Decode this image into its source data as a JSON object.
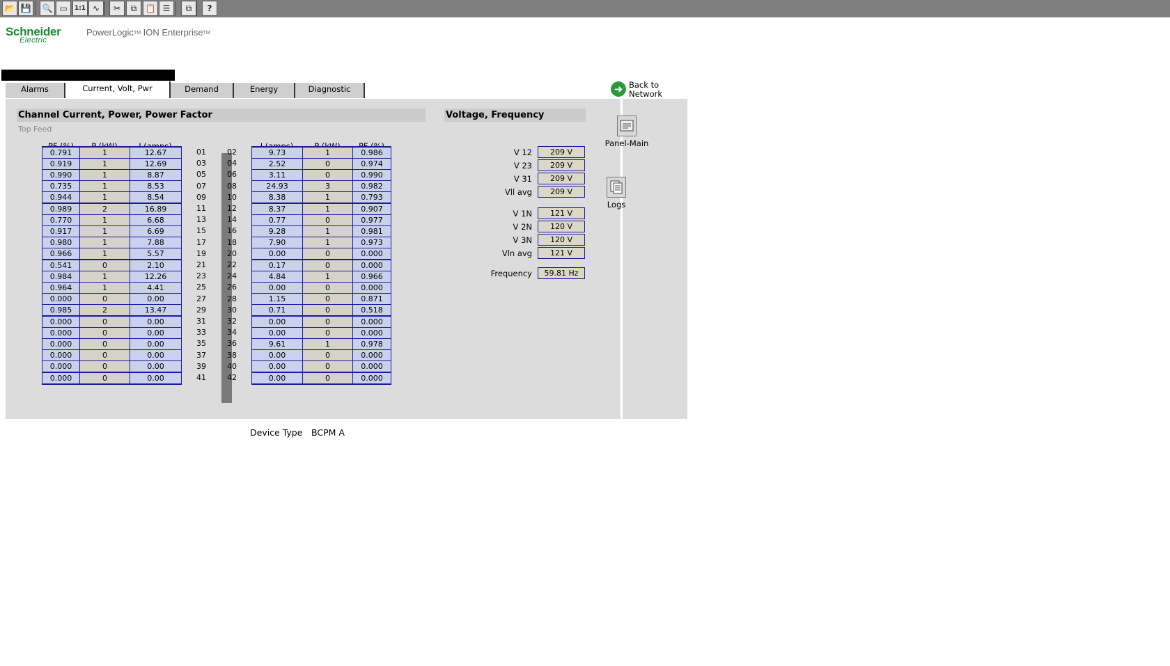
{
  "toolbar": {
    "buttons": [
      {
        "name": "open-icon",
        "glyph": "📂"
      },
      {
        "name": "save-icon",
        "glyph": "💾"
      },
      {
        "name": "zoom-icon",
        "glyph": "🔍"
      },
      {
        "name": "fit-window-icon",
        "glyph": "▭"
      },
      {
        "name": "actual-size-icon",
        "glyph": "1:1"
      },
      {
        "name": "trend-icon",
        "glyph": "∿"
      },
      {
        "name": "cut-icon",
        "glyph": "✂"
      },
      {
        "name": "copy-icon",
        "glyph": "⧉"
      },
      {
        "name": "paste-icon",
        "glyph": "📋"
      },
      {
        "name": "list-icon",
        "glyph": "☰"
      },
      {
        "name": "cascade-windows-icon",
        "glyph": "⧉"
      },
      {
        "name": "help-icon",
        "glyph": "?"
      }
    ]
  },
  "brand": {
    "logo_line1": "Schneider",
    "logo_line2": "Electric",
    "product": "PowerLogic",
    "tm": "TM",
    "product2": " ION Enterprise",
    "tm2": "TM",
    "color": "#1a8a2e"
  },
  "tabs": [
    {
      "label": "Alarms",
      "active": false
    },
    {
      "label": "Current, Volt, Pwr",
      "active": true
    },
    {
      "label": "Demand",
      "active": false
    },
    {
      "label": "Energy",
      "active": false
    },
    {
      "label": "Diagnostic",
      "active": false
    }
  ],
  "back_link": {
    "line1": "Back to",
    "line2": "Network"
  },
  "channels": {
    "title": "Channel Current, Power, Power Factor",
    "subtitle": "Top Feed",
    "left_headers": [
      "PF (%)",
      "P (kW)",
      "I (amps)"
    ],
    "right_headers": [
      "I (amps)",
      "P (kW)",
      "PF (%)"
    ],
    "rows": [
      {
        "l_pf": "0.791",
        "l_p": "1",
        "l_i": "12.67",
        "l_ch": "01",
        "r_ch": "02",
        "r_i": "9.73",
        "r_p": "1",
        "r_pf": "0.986"
      },
      {
        "l_pf": "0.919",
        "l_p": "1",
        "l_i": "12.69",
        "l_ch": "03",
        "r_ch": "04",
        "r_i": "2.52",
        "r_p": "0",
        "r_pf": "0.974"
      },
      {
        "l_pf": "0.990",
        "l_p": "1",
        "l_i": "8.87",
        "l_ch": "05",
        "r_ch": "06",
        "r_i": "3.11",
        "r_p": "0",
        "r_pf": "0.990"
      },
      {
        "l_pf": "0.735",
        "l_p": "1",
        "l_i": "8.53",
        "l_ch": "07",
        "r_ch": "08",
        "r_i": "24.93",
        "r_p": "3",
        "r_pf": "0.982"
      },
      {
        "l_pf": "0.944",
        "l_p": "1",
        "l_i": "8.54",
        "l_ch": "09",
        "r_ch": "10",
        "r_i": "8.38",
        "r_p": "1",
        "r_pf": "0.793"
      },
      {
        "l_pf": "0.989",
        "l_p": "2",
        "l_i": "16.89",
        "l_ch": "11",
        "r_ch": "12",
        "r_i": "8.37",
        "r_p": "1",
        "r_pf": "0.907"
      },
      {
        "l_pf": "0.770",
        "l_p": "1",
        "l_i": "6.68",
        "l_ch": "13",
        "r_ch": "14",
        "r_i": "0.77",
        "r_p": "0",
        "r_pf": "0.977"
      },
      {
        "l_pf": "0.917",
        "l_p": "1",
        "l_i": "6.69",
        "l_ch": "15",
        "r_ch": "16",
        "r_i": "9.28",
        "r_p": "1",
        "r_pf": "0.981"
      },
      {
        "l_pf": "0.980",
        "l_p": "1",
        "l_i": "7.88",
        "l_ch": "17",
        "r_ch": "18",
        "r_i": "7.90",
        "r_p": "1",
        "r_pf": "0.973"
      },
      {
        "l_pf": "0.966",
        "l_p": "1",
        "l_i": "5.57",
        "l_ch": "19",
        "r_ch": "20",
        "r_i": "0.00",
        "r_p": "0",
        "r_pf": "0.000"
      },
      {
        "l_pf": "0.541",
        "l_p": "0",
        "l_i": "2.10",
        "l_ch": "21",
        "r_ch": "22",
        "r_i": "0.17",
        "r_p": "0",
        "r_pf": "0.000"
      },
      {
        "l_pf": "0.984",
        "l_p": "1",
        "l_i": "12.26",
        "l_ch": "23",
        "r_ch": "24",
        "r_i": "4.84",
        "r_p": "1",
        "r_pf": "0.966"
      },
      {
        "l_pf": "0.964",
        "l_p": "1",
        "l_i": "4.41",
        "l_ch": "25",
        "r_ch": "26",
        "r_i": "0.00",
        "r_p": "0",
        "r_pf": "0.000"
      },
      {
        "l_pf": "0.000",
        "l_p": "0",
        "l_i": "0.00",
        "l_ch": "27",
        "r_ch": "28",
        "r_i": "1.15",
        "r_p": "0",
        "r_pf": "0.871"
      },
      {
        "l_pf": "0.985",
        "l_p": "2",
        "l_i": "13.47",
        "l_ch": "29",
        "r_ch": "30",
        "r_i": "0.71",
        "r_p": "0",
        "r_pf": "0.518"
      },
      {
        "l_pf": "0.000",
        "l_p": "0",
        "l_i": "0.00",
        "l_ch": "31",
        "r_ch": "32",
        "r_i": "0.00",
        "r_p": "0",
        "r_pf": "0.000"
      },
      {
        "l_pf": "0.000",
        "l_p": "0",
        "l_i": "0.00",
        "l_ch": "33",
        "r_ch": "34",
        "r_i": "0.00",
        "r_p": "0",
        "r_pf": "0.000"
      },
      {
        "l_pf": "0.000",
        "l_p": "0",
        "l_i": "0.00",
        "l_ch": "35",
        "r_ch": "36",
        "r_i": "9.61",
        "r_p": "1",
        "r_pf": "0.978"
      },
      {
        "l_pf": "0.000",
        "l_p": "0",
        "l_i": "0.00",
        "l_ch": "37",
        "r_ch": "38",
        "r_i": "0.00",
        "r_p": "0",
        "r_pf": "0.000"
      },
      {
        "l_pf": "0.000",
        "l_p": "0",
        "l_i": "0.00",
        "l_ch": "39",
        "r_ch": "40",
        "r_i": "0.00",
        "r_p": "0",
        "r_pf": "0.000"
      },
      {
        "l_pf": "0.000",
        "l_p": "0",
        "l_i": "0.00",
        "l_ch": "41",
        "r_ch": "42",
        "r_i": "0.00",
        "r_p": "0",
        "r_pf": "0.000"
      }
    ]
  },
  "voltage": {
    "title": "Voltage, Frequency",
    "ll": [
      {
        "label": "V 12",
        "value": "209 V"
      },
      {
        "label": "V 23",
        "value": "209 V"
      },
      {
        "label": "V 31",
        "value": "209 V"
      },
      {
        "label": "Vll avg",
        "value": "209 V"
      }
    ],
    "ln": [
      {
        "label": "V 1N",
        "value": "121 V"
      },
      {
        "label": "V 2N",
        "value": "120 V"
      },
      {
        "label": "V 3N",
        "value": "120 V"
      },
      {
        "label": "Vln avg",
        "value": "121 V"
      }
    ],
    "frequency": {
      "label": "Frequency",
      "value": "59.81 Hz"
    }
  },
  "side": {
    "panel_main": "Panel-Main",
    "logs": "Logs"
  },
  "device": {
    "label": "Device Type",
    "value": "BCPM A"
  }
}
